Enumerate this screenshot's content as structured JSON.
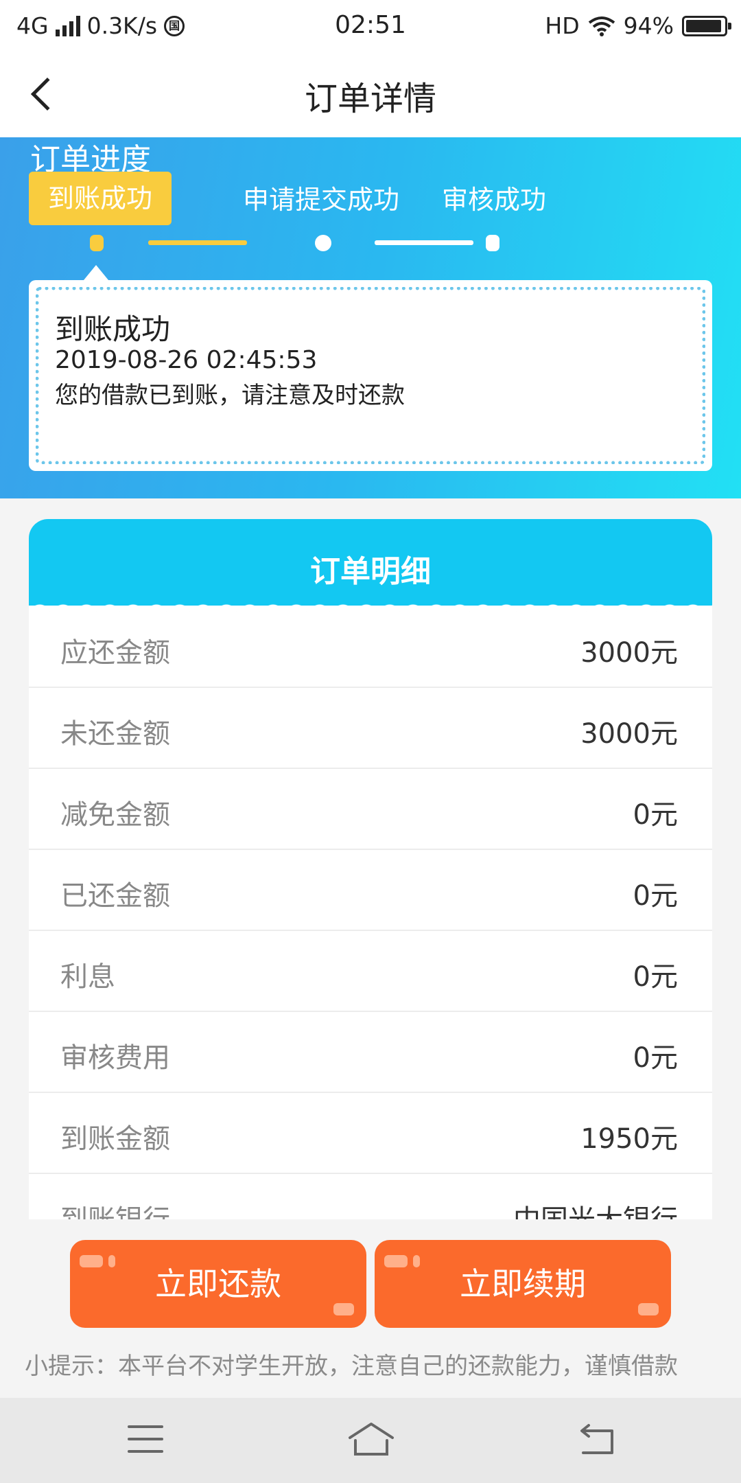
{
  "status_bar": {
    "network": "4G",
    "speed": "0.3K/s",
    "badge": "国",
    "time": "02:51",
    "hd": "HD",
    "battery": "94%",
    "battery_level": 0.94
  },
  "nav": {
    "title": "订单详情",
    "back_icon": "chevron-left-icon"
  },
  "progress": {
    "title": "订单进度",
    "steps": [
      {
        "label": "到账成功",
        "active": true
      },
      {
        "label": "申请提交成功",
        "active": false
      },
      {
        "label": "审核成功",
        "active": false
      }
    ],
    "message": {
      "title": "到账成功",
      "time": "2019-08-26 02:45:53",
      "text": "您的借款已到账，请注意及时还款"
    }
  },
  "details": {
    "title": "订单明细",
    "rows": [
      {
        "label": "应还金额",
        "value": "3000元"
      },
      {
        "label": "未还金额",
        "value": "3000元"
      },
      {
        "label": "减免金额",
        "value": "0元"
      },
      {
        "label": "已还金额",
        "value": "0元"
      },
      {
        "label": "利息",
        "value": "0元"
      },
      {
        "label": "审核费用",
        "value": "0元"
      },
      {
        "label": "到账金额",
        "value": "1950元"
      },
      {
        "label": "到账银行",
        "value": "中国光大银行"
      }
    ]
  },
  "actions": {
    "repay": "立即还款",
    "renew": "立即续期",
    "tip": "小提示：本平台不对学生开放，注意自己的还款能力，谨慎借款"
  },
  "colors": {
    "accent_blue": "#13c8f2",
    "active_step": "#f9cc3e",
    "button_orange": "#fb6a2c"
  },
  "system_nav": {
    "icons": [
      "menu-icon",
      "home-icon",
      "back-icon"
    ]
  }
}
